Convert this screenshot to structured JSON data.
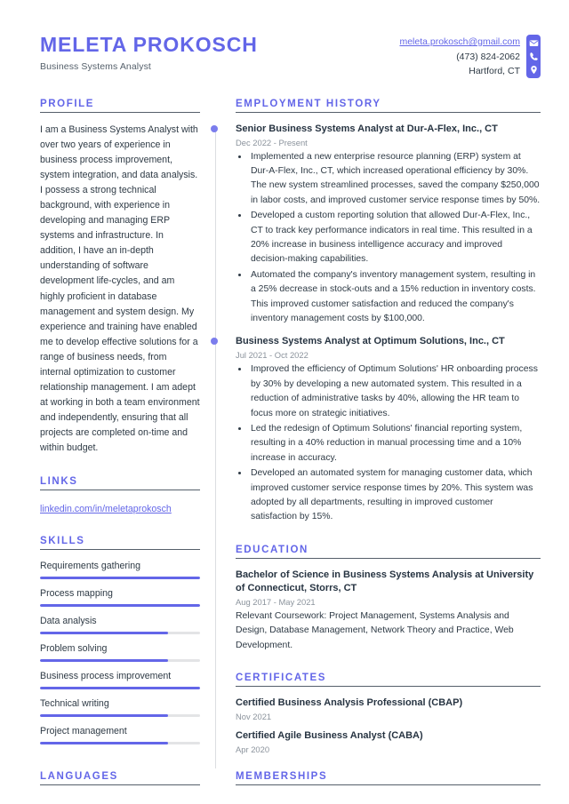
{
  "header": {
    "full_name": "MELETA PROKOSCH",
    "job_title": "Business Systems Analyst",
    "contact": {
      "email": "meleta.prokosch@gmail.com",
      "phone": "(473) 824-2062",
      "location": "Hartford, CT",
      "icons": [
        "envelope-icon",
        "phone-icon",
        "location-pin-icon"
      ]
    }
  },
  "colors": {
    "accent": "#6366e8",
    "text": "#2e3a45",
    "muted": "#8b939c",
    "rule": "#555f6a",
    "track": "#e3e4e6"
  },
  "left": {
    "profile": {
      "title": "PROFILE",
      "text": "I am a Business Systems Analyst with over two years of experience in business process improvement, system integration, and data analysis. I possess a strong technical background, with experience in developing and managing ERP systems and infrastructure. In addition, I have an in-depth understanding of software development life-cycles, and am highly proficient in database management and system design. My experience and training have enabled me to develop effective solutions for a range of business needs, from internal optimization to customer relationship management. I am adept at working in both a team environment and independently, ensuring that all projects are completed on-time and within budget."
    },
    "links": {
      "title": "LINKS",
      "items": [
        {
          "label": "linkedin.com/in/meletaprokosch"
        }
      ]
    },
    "skills": {
      "title": "SKILLS",
      "items": [
        {
          "label": "Requirements gathering",
          "level": 100
        },
        {
          "label": "Process mapping",
          "level": 100
        },
        {
          "label": "Data analysis",
          "level": 80
        },
        {
          "label": "Problem solving",
          "level": 80
        },
        {
          "label": "Business process improvement",
          "level": 100
        },
        {
          "label": "Technical writing",
          "level": 80
        },
        {
          "label": "Project management",
          "level": 80
        }
      ]
    },
    "languages": {
      "title": "LANGUAGES"
    }
  },
  "right": {
    "employment": {
      "title": "EMPLOYMENT HISTORY",
      "jobs": [
        {
          "title": "Senior Business Systems Analyst at Dur-A-Flex, Inc., CT",
          "date": "Dec 2022 - Present",
          "bullets": [
            "Implemented a new enterprise resource planning (ERP) system at Dur-A-Flex, Inc., CT, which increased operational efficiency by 30%. The new system streamlined processes, saved the company $250,000 in labor costs, and improved customer service response times by 50%.",
            "Developed a custom reporting solution that allowed Dur-A-Flex, Inc., CT to track key performance indicators in real time. This resulted in a 20% increase in business intelligence accuracy and improved decision-making capabilities.",
            "Automated the company's inventory management system, resulting in a 25% decrease in stock-outs and a 15% reduction in inventory costs. This improved customer satisfaction and reduced the company's inventory management costs by $100,000."
          ]
        },
        {
          "title": "Business Systems Analyst at Optimum Solutions, Inc., CT",
          "date": "Jul 2021 - Oct 2022",
          "bullets": [
            "Improved the efficiency of Optimum Solutions' HR onboarding process by 30% by developing a new automated system. This resulted in a reduction of administrative tasks by 40%, allowing the HR team to focus more on strategic initiatives.",
            "Led the redesign of Optimum Solutions' financial reporting system, resulting in a 40% reduction in manual processing time and a 10% increase in accuracy.",
            "Developed an automated system for managing customer data, which improved customer service response times by 20%. This system was adopted by all departments, resulting in improved customer satisfaction by 15%."
          ]
        }
      ]
    },
    "education": {
      "title": "EDUCATION",
      "items": [
        {
          "degree": "Bachelor of Science in Business Systems Analysis at University of Connecticut, Storrs, CT",
          "date": "Aug 2017 - May 2021",
          "desc": "Relevant Coursework: Project Management, Systems Analysis and Design, Database Management, Network Theory and Practice, Web Development."
        }
      ]
    },
    "certificates": {
      "title": "CERTIFICATES",
      "items": [
        {
          "name": "Certified Business Analysis Professional (CBAP)",
          "date": "Nov 2021"
        },
        {
          "name": "Certified Agile Business Analyst (CABA)",
          "date": "Apr 2020"
        }
      ]
    },
    "memberships": {
      "title": "MEMBERSHIPS"
    }
  }
}
